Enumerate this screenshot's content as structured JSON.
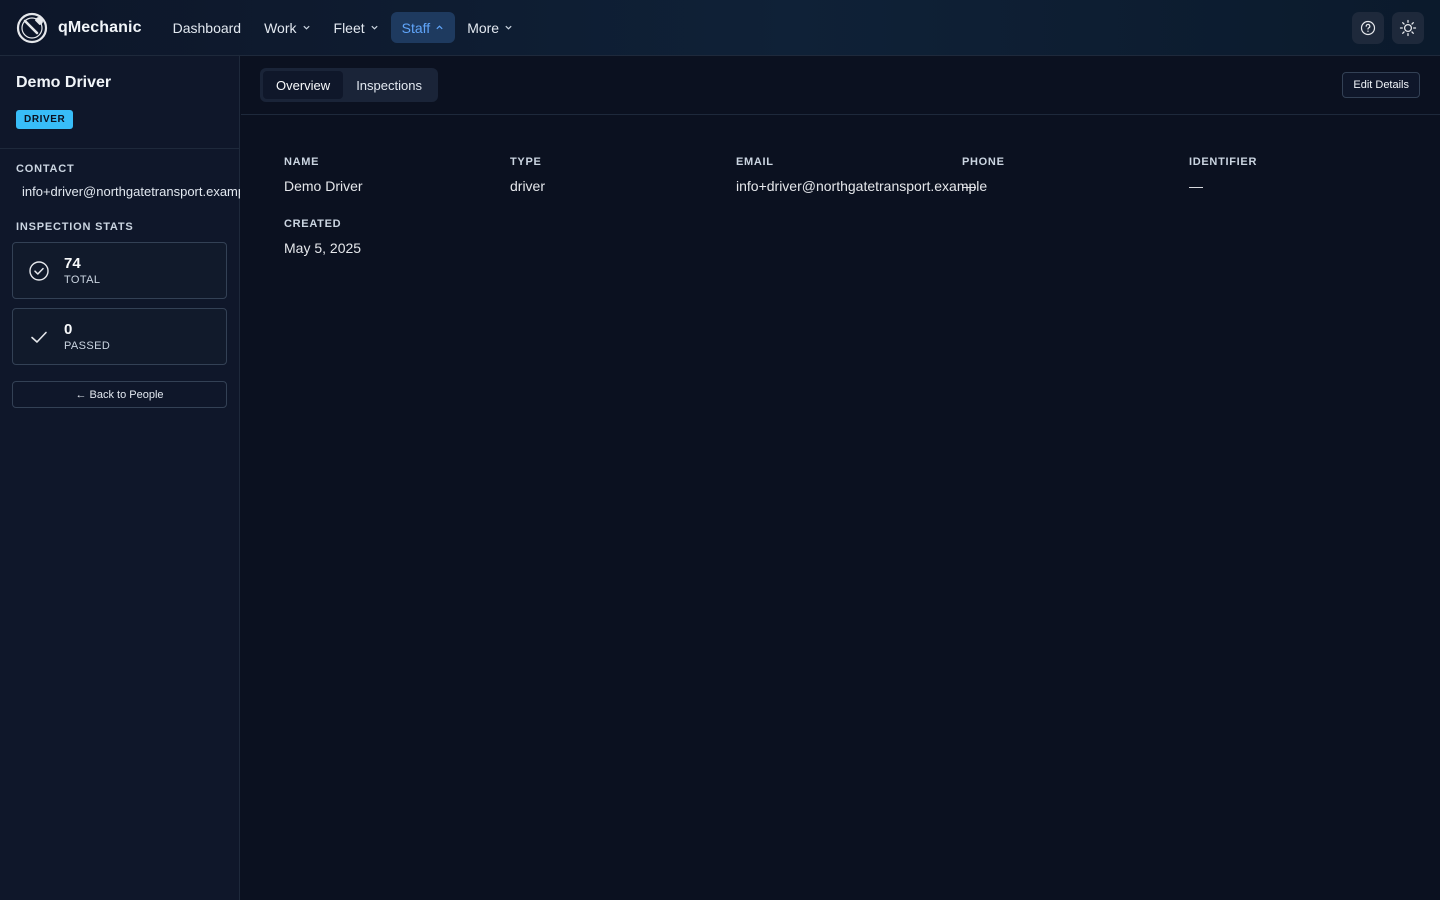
{
  "brand": {
    "name": "qMechanic"
  },
  "nav": {
    "items": [
      {
        "label": "Dashboard",
        "dropdown": false,
        "active": false
      },
      {
        "label": "Work",
        "dropdown": true,
        "active": false
      },
      {
        "label": "Fleet",
        "dropdown": true,
        "active": false
      },
      {
        "label": "Staff",
        "dropdown": true,
        "active": true
      },
      {
        "label": "More",
        "dropdown": true,
        "active": false
      }
    ]
  },
  "top_actions": {
    "help_icon": "help-circle-icon",
    "theme_icon": "sun-icon"
  },
  "sidebar": {
    "name": "Demo Driver",
    "badge": "DRIVER",
    "contact_label": "CONTACT",
    "email": "info+driver@northgatetransport.example",
    "stats_label": "INSPECTION STATS",
    "stats": [
      {
        "value": "74",
        "caption": "TOTAL",
        "icon": "check-circle-icon"
      },
      {
        "value": "0",
        "caption": "PASSED",
        "icon": "check-icon"
      }
    ],
    "back_label": "← Back to People"
  },
  "main": {
    "tabs": [
      {
        "label": "Overview",
        "active": true
      },
      {
        "label": "Inspections",
        "active": false
      }
    ],
    "edit_label": "Edit Details",
    "fields": {
      "name": {
        "label": "NAME",
        "value": "Demo Driver"
      },
      "type": {
        "label": "TYPE",
        "value": "driver"
      },
      "email": {
        "label": "EMAIL",
        "value": "info+driver@northgatetransport.example"
      },
      "phone": {
        "label": "PHONE",
        "value": "—"
      },
      "identifier": {
        "label": "IDENTIFIER",
        "value": "—"
      },
      "created": {
        "label": "CREATED",
        "value": "May 5, 2025"
      }
    }
  },
  "colors": {
    "accent": "#38bdf8",
    "active_nav_bg": "#1e3a5f",
    "active_nav_text": "#60a5fa",
    "background": "#0b1120"
  }
}
